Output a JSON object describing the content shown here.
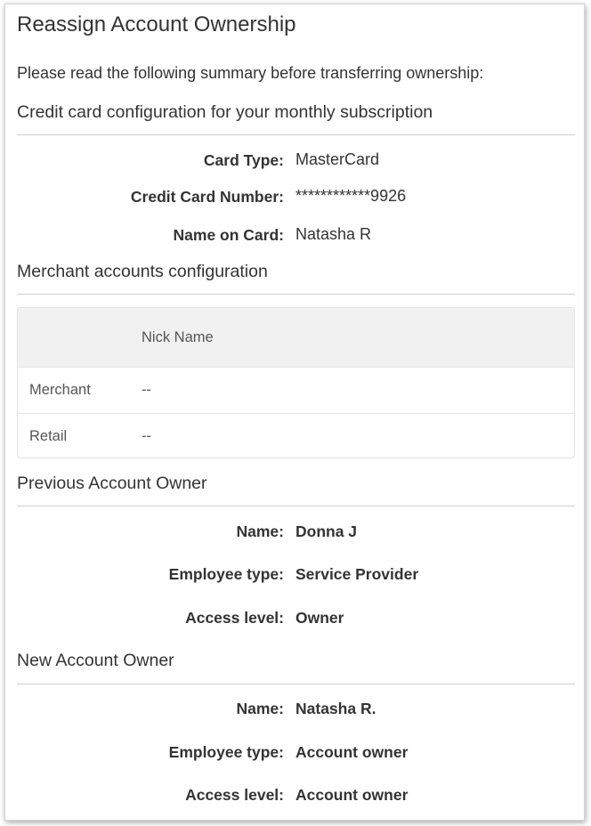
{
  "page": {
    "title": "Reassign Account Ownership",
    "intro": "Please read the following summary before transferring ownership:"
  },
  "credit_card": {
    "heading": "Credit card configuration for your monthly subscription",
    "card_type_label": "Card Type:",
    "card_type_value": "MasterCard",
    "number_label": "Credit Card Number:",
    "number_value": "************9926",
    "name_label": "Name on Card:",
    "name_value": "Natasha R"
  },
  "merchant": {
    "heading": "Merchant accounts configuration",
    "column_header": "Nick Name",
    "rows": [
      {
        "type": "Merchant",
        "nickname": "--"
      },
      {
        "type": "Retail",
        "nickname": "--"
      }
    ]
  },
  "previous_owner": {
    "heading": "Previous Account Owner",
    "name_label": "Name:",
    "name_value": "Donna J",
    "type_label": "Employee type:",
    "type_value": "Service Provider",
    "access_label": "Access level:",
    "access_value": "Owner"
  },
  "new_owner": {
    "heading": "New Account Owner",
    "name_label": "Name:",
    "name_value": "Natasha R.",
    "type_label": "Employee type:",
    "type_value": "Account owner",
    "access_label": "Access level:",
    "access_value": "Account owner"
  }
}
